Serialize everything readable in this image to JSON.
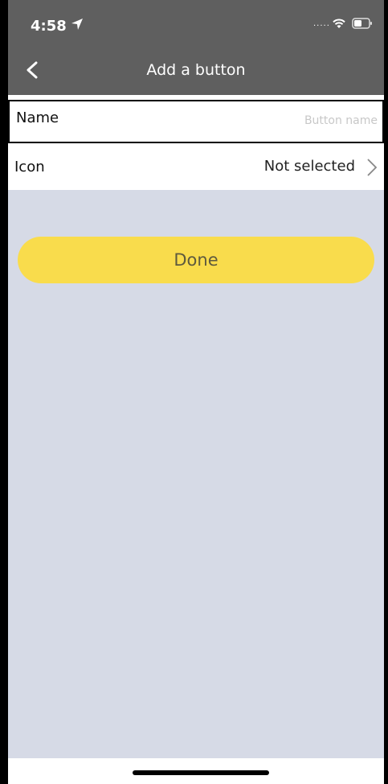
{
  "status": {
    "time": "4:58",
    "signal_dots": ".....",
    "icons": [
      "location-arrow-icon",
      "wifi-icon",
      "battery-icon"
    ]
  },
  "nav": {
    "title": "Add a button",
    "back_icon": "chevron-left-icon"
  },
  "form": {
    "name_label": "Name",
    "name_value": "",
    "name_placeholder": "Button name",
    "icon_label": "Icon",
    "icon_value": "Not selected",
    "icon_chevron": "chevron-right-icon"
  },
  "actions": {
    "done_label": "Done"
  },
  "colors": {
    "header_bg": "#5f5f5f",
    "content_bg": "#d6dae6",
    "done_bg": "#f9dc4c"
  }
}
